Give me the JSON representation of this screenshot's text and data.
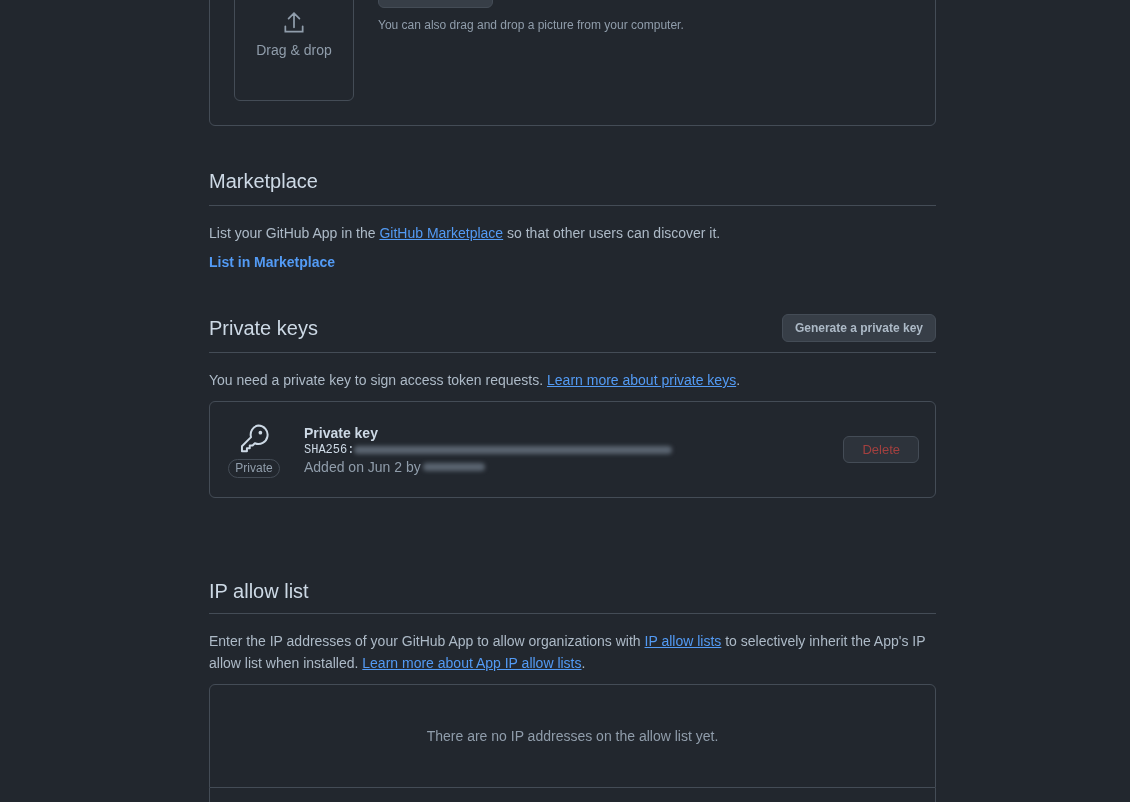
{
  "upload": {
    "dropzone_label": "Drag & drop",
    "hint": "You can also drag and drop a picture from your computer."
  },
  "marketplace": {
    "heading": "Marketplace",
    "text_before": "List your GitHub App in the ",
    "link": "GitHub Marketplace",
    "text_after": " so that other users can discover it.",
    "action": "List in Marketplace"
  },
  "private_keys": {
    "heading": "Private keys",
    "button": "Generate a private key",
    "text_before": "You need a private key to sign access token requests. ",
    "link": "Learn more about private keys",
    "text_after": ".",
    "keys": [
      {
        "badge": "Private",
        "title": "Private key",
        "fingerprint_label": "SHA256:",
        "added": "Added on Jun 2 by",
        "delete": "Delete"
      }
    ]
  },
  "ip_allow_list": {
    "heading": "IP allow list",
    "text_before": "Enter the IP addresses of your GitHub App to allow organizations with ",
    "link": "IP allow lists",
    "text_middle": " to selectively inherit the App's IP allow list when installed. ",
    "link2": "Learn more about App IP allow lists",
    "text_after": ".",
    "empty": "There are no IP addresses on the allow list yet."
  }
}
